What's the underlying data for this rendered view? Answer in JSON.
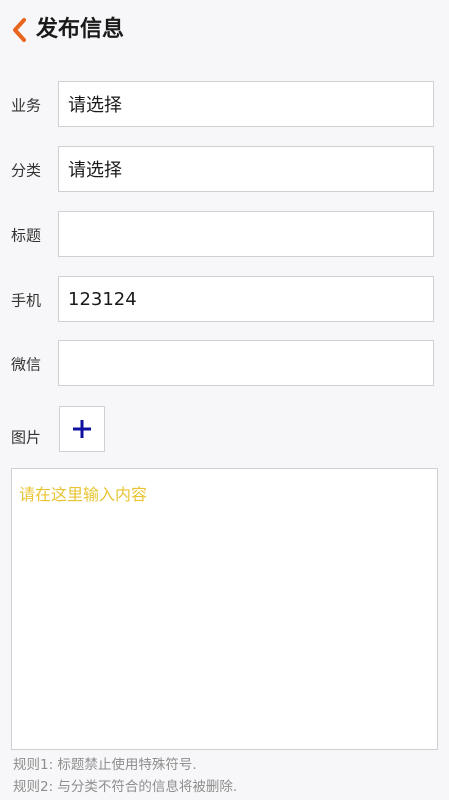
{
  "header": {
    "title": "发布信息",
    "back_icon": "chevron-left-icon",
    "accent_color": "#e8651e"
  },
  "form": {
    "business": {
      "label": "业务",
      "value": "请选择"
    },
    "category": {
      "label": "分类",
      "value": "请选择"
    },
    "title": {
      "label": "标题",
      "value": ""
    },
    "phone": {
      "label": "手机",
      "value": "123124"
    },
    "wechat": {
      "label": "微信",
      "value": ""
    },
    "images": {
      "label": "图片",
      "add_icon": "plus-icon",
      "add_icon_color": "#1010a0"
    }
  },
  "content": {
    "placeholder": "请在这里输入内容",
    "placeholder_color": "#e8c435"
  },
  "rules": [
    "规则1: 标题禁止使用特殊符号.",
    "规则2: 与分类不符合的信息将被删除."
  ]
}
